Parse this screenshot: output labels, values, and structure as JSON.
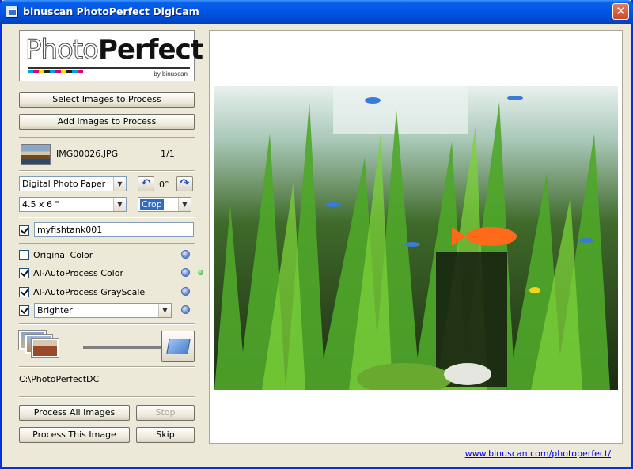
{
  "window": {
    "title": "binuscan PhotoPerfect DigiCam",
    "close_symbol": "✕"
  },
  "logo": {
    "word1": "Photo",
    "word2": "Perfect",
    "tagline": "by binuscan"
  },
  "buttons": {
    "select_images": "Select Images to Process",
    "add_images": "Add Images to Process",
    "process_all": "Process All Images",
    "stop": "Stop",
    "process_this": "Process This Image",
    "skip": "Skip"
  },
  "file": {
    "name": "IMG00026.JPG",
    "counter": "1/1"
  },
  "output": {
    "paper": "Digital Photo Paper",
    "size": "4.5 x 6 \"",
    "rotation": "0°",
    "fit_mode": "Crop"
  },
  "filename_option": {
    "checked": true,
    "value": "myfishtank001"
  },
  "options": [
    {
      "label": "Original Color",
      "checked": false,
      "active": false
    },
    {
      "label": "AI-AutoProcess Color",
      "checked": true,
      "active": true
    },
    {
      "label": "AI-AutoProcess GrayScale",
      "checked": true,
      "active": false
    }
  ],
  "adjustment": {
    "checked": true,
    "value": "Brighter"
  },
  "destination_path": "C:\\PhotoPerfectDC",
  "footer_link": "www.binuscan.com/photoperfect/",
  "colors": {
    "title_bar": "#0055e5",
    "selection": "#316ac5",
    "active_led": "#1f9c16"
  }
}
